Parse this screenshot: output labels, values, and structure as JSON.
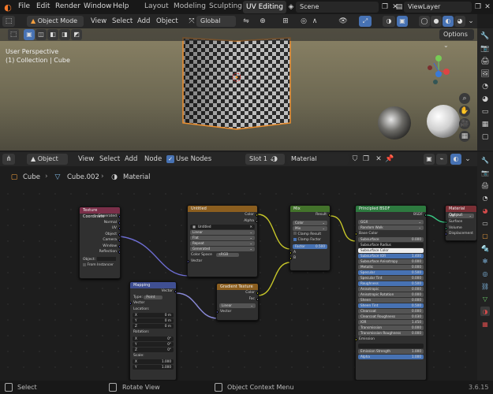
{
  "menu": {
    "file": "File",
    "edit": "Edit",
    "render": "Render",
    "window": "Window",
    "help": "Help"
  },
  "workspaces": [
    "Layout",
    "Modeling",
    "Sculpting",
    "UV Editing"
  ],
  "scene": "Scene",
  "view_layer": "ViewLayer",
  "viewport_header": {
    "mode": "Object Mode",
    "view": "View",
    "select": "Select",
    "add": "Add",
    "object": "Object",
    "orientation": "Global"
  },
  "options": "Options",
  "viewport_overlay": {
    "perspective": "User Perspective",
    "collection": "(1) Collection | Cube"
  },
  "node_header": {
    "type": "Object",
    "view": "View",
    "select": "Select",
    "add": "Add",
    "node": "Node",
    "use_nodes": "Use Nodes",
    "slot": "Slot 1",
    "material": "Material"
  },
  "breadcrumb": {
    "object": "Cube",
    "mesh": "Cube.002",
    "material": "Material"
  },
  "nodes": {
    "tex_coord": {
      "title": "Texture Coordinate",
      "outputs": [
        "Generated",
        "Normal",
        "UV",
        "Object",
        "Camera",
        "Window",
        "Reflection"
      ],
      "object_label": "Object:",
      "from_instancer": "From Instancer"
    },
    "mapping": {
      "title": "Mapping",
      "out": "Vector",
      "type_label": "Type:",
      "type": "Point",
      "in": "Vector",
      "location": "Location:",
      "rotation": "Rotation:",
      "scale": "Scale:",
      "loc": [
        [
          "X",
          "0 m"
        ],
        [
          "Y",
          "0 m"
        ],
        [
          "Z",
          "0 m"
        ]
      ],
      "rot": [
        [
          "X",
          "0°"
        ],
        [
          "Y",
          "0°"
        ],
        [
          "Z",
          "0°"
        ]
      ],
      "scl": [
        [
          "X",
          "1.000"
        ],
        [
          "Y",
          "1.000"
        ]
      ]
    },
    "image": {
      "title": "Untitled",
      "outputs": [
        "Color",
        "Alpha"
      ],
      "image": "Untitled",
      "interp": "Linear",
      "proj": "Flat",
      "ext": "Repeat",
      "source": "Generated",
      "cs_label": "Color Space",
      "cs": "sRGB",
      "vector": "Vector"
    },
    "gradient": {
      "title": "Gradient Texture",
      "outputs": [
        "Color",
        "Fac"
      ],
      "type": "Linear",
      "vector": "Vector"
    },
    "mix": {
      "title": "Mix",
      "result": "Result",
      "dtype": "Color",
      "blend": "Mix",
      "clamp_result": "Clamp Result",
      "clamp_factor": "Clamp Factor",
      "factor": "Factor",
      "factor_val": "0.500",
      "a": "A",
      "b": "B"
    },
    "bsdf": {
      "title": "Principled BSDF",
      "out": "BSDF",
      "dist": "GGX",
      "sss": "Random Walk",
      "base_color": "Base Color",
      "rows": [
        [
          "Subsurface",
          "0.000",
          "field"
        ],
        [
          "Subsurface Radius",
          "",
          "drop"
        ],
        [
          "Subsurface Color",
          "",
          "white"
        ],
        [
          "Subsurface IOR",
          "1.400",
          "blue"
        ],
        [
          "Subsurface Anisotropy",
          "0.000",
          "field"
        ],
        [
          "Metallic",
          "0.000",
          "field"
        ],
        [
          "Specular",
          "0.500",
          "blue"
        ],
        [
          "Specular Tint",
          "0.000",
          "field"
        ],
        [
          "Roughness",
          "0.500",
          "blue"
        ],
        [
          "Anisotropic",
          "0.000",
          "field"
        ],
        [
          "Anisotropic Rotation",
          "0.000",
          "field"
        ],
        [
          "Sheen",
          "0.000",
          "field"
        ],
        [
          "Sheen Tint",
          "0.500",
          "blue"
        ],
        [
          "Clearcoat",
          "0.000",
          "field"
        ],
        [
          "Clearcoat Roughness",
          "0.030",
          "field"
        ],
        [
          "IOR",
          "1.450",
          "field"
        ],
        [
          "Transmission",
          "0.000",
          "field"
        ],
        [
          "Transmission Roughness",
          "0.000",
          "field"
        ]
      ],
      "emission": "Emission",
      "emission_strength": "Emission Strength",
      "emission_strength_val": "1.000",
      "alpha": "Alpha",
      "alpha_val": "1.000"
    },
    "output": {
      "title": "Material Output",
      "target": "All",
      "inputs": [
        "Surface",
        "Volume",
        "Displacement"
      ]
    }
  },
  "status": {
    "select": "Select",
    "rotate": "Rotate View",
    "context": "Object Context Menu",
    "version": "3.6.15"
  },
  "colors": {
    "accent": "#4772b3",
    "selection": "#f0902e",
    "texture_header": "#7a2f49",
    "vector_header": "#3f4f92",
    "color_header": "#8b5e1f",
    "converter_header": "#43732b",
    "shader_header": "#2d7a3f",
    "output_header": "#7a2f35"
  }
}
